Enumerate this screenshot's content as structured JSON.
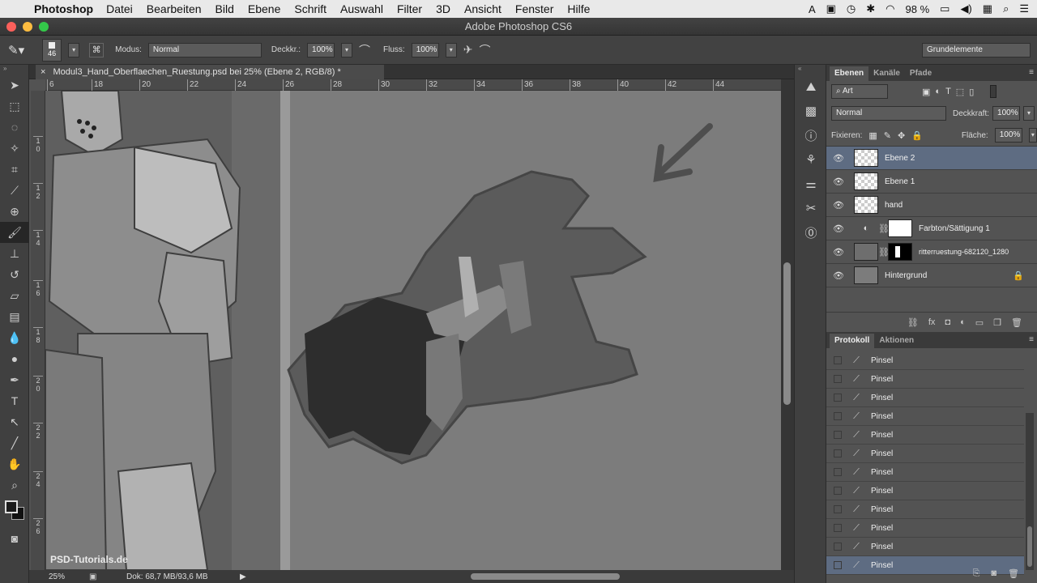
{
  "menubar": {
    "app": "Photoshop",
    "items": [
      "Datei",
      "Bearbeiten",
      "Bild",
      "Ebene",
      "Schrift",
      "Auswahl",
      "Filter",
      "3D",
      "Ansicht",
      "Fenster",
      "Hilfe"
    ],
    "battery": "98 %"
  },
  "window": {
    "title": "Adobe Photoshop CS6"
  },
  "options": {
    "brush_size": "46",
    "mode_label": "Modus:",
    "mode_value": "Normal",
    "opacity_label": "Deckkr.:",
    "opacity_value": "100%",
    "flow_label": "Fluss:",
    "flow_value": "100%",
    "workspace": "Grundelemente"
  },
  "document": {
    "tab_title": "Modul3_Hand_Oberflaechen_Ruestung.psd bei 25% (Ebene 2, RGB/8) *",
    "ruler_h": [
      "6",
      "18",
      "20",
      "22",
      "24",
      "26",
      "28",
      "30",
      "32",
      "34",
      "36",
      "38",
      "40",
      "42",
      "44"
    ],
    "ruler_v": [
      "1\n0",
      "1\n2",
      "1\n4",
      "1\n6",
      "1\n8",
      "2\n0",
      "2\n2",
      "2\n4",
      "2\n6"
    ]
  },
  "status": {
    "zoom": "25%",
    "doc": "Dok: 68,7 MB/93,6 MB"
  },
  "watermark": "PSD-Tutorials.de",
  "layers_panel": {
    "tabs": [
      "Ebenen",
      "Kanäle",
      "Pfade"
    ],
    "filter": "Art",
    "blend_mode": "Normal",
    "opacity_label": "Deckkraft:",
    "opacity_value": "100%",
    "lock_label": "Fixieren:",
    "fill_label": "Fläche:",
    "fill_value": "100%",
    "layers": [
      {
        "name": "Ebene 2",
        "selected": true
      },
      {
        "name": "Ebene 1",
        "selected": false
      },
      {
        "name": "hand",
        "selected": false
      },
      {
        "name": "Farbton/Sättigung 1",
        "selected": false
      },
      {
        "name": "ritterruestung-682120_1280",
        "selected": false
      },
      {
        "name": "Hintergrund",
        "selected": false
      }
    ]
  },
  "history_panel": {
    "tabs": [
      "Protokoll",
      "Aktionen"
    ],
    "items": [
      "Pinsel",
      "Pinsel",
      "Pinsel",
      "Pinsel",
      "Pinsel",
      "Pinsel",
      "Pinsel",
      "Pinsel",
      "Pinsel",
      "Pinsel",
      "Pinsel",
      "Pinsel"
    ]
  },
  "colors": {
    "panel_bg": "#535353",
    "selection": "#5e6c82",
    "canvas": "#7c7c7c"
  }
}
